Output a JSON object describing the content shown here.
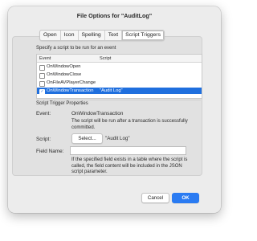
{
  "dialog": {
    "title": "File Options for \"AuditLog\""
  },
  "tabs": [
    {
      "label": "Open"
    },
    {
      "label": "Icon"
    },
    {
      "label": "Spelling"
    },
    {
      "label": "Text"
    },
    {
      "label": "Script Triggers",
      "selected": true
    }
  ],
  "triggers": {
    "instruction": "Specify a script to be run for an event",
    "col_event": "Event",
    "col_script": "Script",
    "rows": [
      {
        "event": "OnWindowOpen",
        "script": "",
        "checked": false,
        "selected": false
      },
      {
        "event": "OnWindowClose",
        "script": "",
        "checked": false,
        "selected": false
      },
      {
        "event": "OnFileAVPlayerChange",
        "script": "",
        "checked": false,
        "selected": false
      },
      {
        "event": "OnWindowTransaction",
        "script": "\"Audit Log\"",
        "checked": true,
        "selected": true
      }
    ]
  },
  "properties": {
    "heading": "Script Trigger Properties",
    "event_label": "Event:",
    "event_value": "OnWindowTransaction",
    "event_description": "The script will be run after a transaction is successfully committed.",
    "script_label": "Script:",
    "select_button": "Select...",
    "script_value": "\"Audit Log\"",
    "fieldname_label": "Field Name:",
    "fieldname_value": "",
    "fieldname_note": "If the specified field exists in a table where the script is called, the field content will be included in the JSON script parameter."
  },
  "footer": {
    "cancel": "Cancel",
    "ok": "OK"
  },
  "colors": {
    "accent": "#2a7bf2",
    "selection": "#1f6fde"
  }
}
